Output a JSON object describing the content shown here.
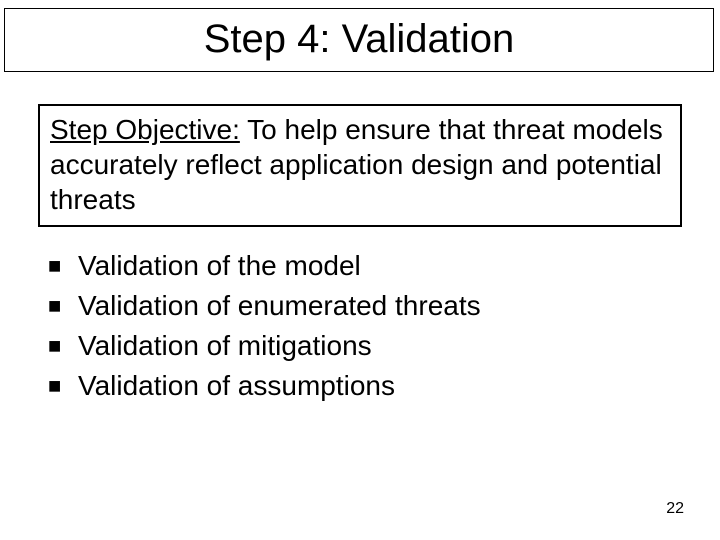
{
  "title": "Step 4: Validation",
  "objective": {
    "label": "Step Objective:",
    "body": " To help ensure that threat models accurately reflect application design and potential threats"
  },
  "bullets": [
    "Validation of the model",
    "Validation of enumerated threats",
    "Validation of mitigations",
    "Validation of assumptions"
  ],
  "page_number": "22",
  "bullet_glyph": "■"
}
